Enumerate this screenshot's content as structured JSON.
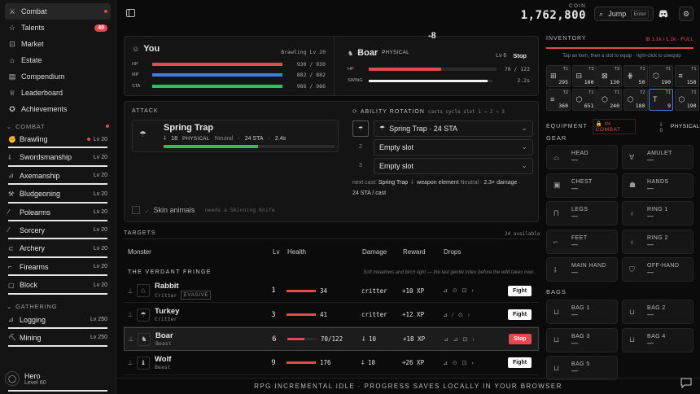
{
  "nav": [
    {
      "label": "Combat",
      "icon": "swords-icon",
      "dot": true
    },
    {
      "label": "Talents",
      "icon": "star-icon",
      "badge": "40"
    },
    {
      "label": "Market",
      "icon": "cart-icon"
    },
    {
      "label": "Estate",
      "icon": "home-icon"
    },
    {
      "label": "Compendium",
      "icon": "book-icon"
    },
    {
      "label": "Leaderboard",
      "icon": "trophy-icon"
    },
    {
      "label": "Achievements",
      "icon": "medal-icon"
    }
  ],
  "combat_section": "COMBAT",
  "combat_skills": [
    {
      "label": "Brawling",
      "lv": "Lv 20",
      "dot": true
    },
    {
      "label": "Swordsmanship",
      "lv": "Lv 20"
    },
    {
      "label": "Axemanship",
      "lv": "Lv 20"
    },
    {
      "label": "Bludgeoning",
      "lv": "Lv 20"
    },
    {
      "label": "Polearms",
      "lv": "Lv 20"
    },
    {
      "label": "Sorcery",
      "lv": "Lv 20"
    },
    {
      "label": "Archery",
      "lv": "Lv 20"
    },
    {
      "label": "Firearms",
      "lv": "Lv 20"
    },
    {
      "label": "Block",
      "lv": "Lv 20"
    }
  ],
  "gathering_section": "GATHERING",
  "gathering_skills": [
    {
      "label": "Logging",
      "lv": "Lv 250"
    },
    {
      "label": "Mining",
      "lv": "Lv 250"
    }
  ],
  "hero": {
    "name": "Hero",
    "level": "Level 60"
  },
  "coin": {
    "label": "COIN",
    "value": "1,762,800"
  },
  "jump": {
    "label": "Jump",
    "kbd": "Enter"
  },
  "damage_popup": "-8",
  "you": {
    "title": "You",
    "skill": "Brawling Lv 20",
    "stats": [
      {
        "k": "HP",
        "v": "930 / 930",
        "pct": 100,
        "color": "#e5484d"
      },
      {
        "k": "MP",
        "v": "882 / 882",
        "pct": 100,
        "color": "#3e7fe6"
      },
      {
        "k": "STA",
        "v": "986 / 986",
        "pct": 100,
        "color": "#2fbf5b"
      }
    ]
  },
  "enemy": {
    "name": "Boar",
    "tag": "PHYSICAL",
    "lv": "Lv 6",
    "stop": "Stop",
    "hp_label": "HP",
    "hp_value": "70 / 122",
    "hp_pct": 57,
    "swing_label": "SWING",
    "swing_value": "2.2s",
    "swing_pct": 96
  },
  "attack": {
    "title": "ATTACK",
    "name": "Spring Trap",
    "dmg": "18",
    "type": "PHYSICAL",
    "element": "Neutral",
    "cost": "24 STA",
    "time": "2.4s",
    "progress": 55
  },
  "rotation": {
    "title": "ABILITY ROTATION",
    "hint": "casts cycle slot 1 → 2 → 3",
    "slots": [
      {
        "num": "",
        "label": "Spring Trap · 24 STA"
      },
      {
        "num": "2",
        "label": "Empty slot"
      },
      {
        "num": "3",
        "label": "Empty slot"
      }
    ],
    "next_label": "next cast:",
    "next_name": "Spring Trap",
    "next_el_label": "weapon element",
    "next_el": "Neutral",
    "next_mult": "2.3× damage",
    "next_cost": "24 STA / cast"
  },
  "skin": {
    "label": "Skin animals",
    "note": "needs a Skinning Knife"
  },
  "targets": {
    "title": "TARGETS",
    "count": "24 available",
    "headers": {
      "monster": "Monster",
      "lv": "Lv",
      "health": "Health",
      "damage": "Damage",
      "reward": "Reward",
      "drops": "Drops"
    },
    "zone": "THE VERDANT FRINGE",
    "zone_desc": "Soft meadows and birch light — the last gentle miles before the wild takes over.",
    "rows": [
      {
        "name": "Rabbit",
        "type": "Critter",
        "tag": "EVASIVE",
        "lv": "1",
        "hp": "34",
        "hp_pct": 100,
        "dmg": "critter",
        "reward": "+10 XP",
        "drops": "⊿ ⊙ ⊡ ›",
        "btn": "Fight",
        "icon": "rabbit-icon"
      },
      {
        "name": "Turkey",
        "type": "Critter",
        "lv": "3",
        "hp": "41",
        "hp_pct": 100,
        "dmg": "critter",
        "reward": "+12 XP",
        "drops": "⊿ ⁄ ⊙ ›",
        "btn": "Fight",
        "icon": "turkey-icon"
      },
      {
        "name": "Boar",
        "type": "Beast",
        "lv": "6",
        "hp": "70/122",
        "hp_pct": 57,
        "dmg": "10",
        "reward": "+18 XP",
        "drops": "⊿ ⊿ ⊡ ›",
        "btn": "Stop",
        "icon": "boar-icon",
        "active": true
      },
      {
        "name": "Wolf",
        "type": "Beast",
        "lv": "9",
        "hp": "176",
        "hp_pct": 100,
        "dmg": "10",
        "reward": "+26 XP",
        "drops": "⊿ ⊙ ⊡ ›",
        "btn": "Fight",
        "icon": "wolf-icon"
      }
    ]
  },
  "inventory": {
    "title": "INVENTORY",
    "capacity": "1.1k / 1.1k · FULL",
    "hint": "Tap an item, then a slot to equip · right-click to unequip",
    "slots": [
      {
        "tier": "T1",
        "count": "295"
      },
      {
        "tier": "T3",
        "count": "100"
      },
      {
        "tier": "T3",
        "count": "130"
      },
      {
        "tier": "T1",
        "count": "50"
      },
      {
        "tier": "T1",
        "count": "190"
      },
      {
        "tier": "T1",
        "count": "150"
      },
      {
        "tier": "T2",
        "count": "360"
      },
      {
        "tier": "T1",
        "count": "651"
      },
      {
        "tier": "T1",
        "count": "240"
      },
      {
        "tier": "T2",
        "count": "180"
      },
      {
        "tier": "T1",
        "count": "9"
      },
      {
        "tier": "T1",
        "count": "190"
      }
    ]
  },
  "equipment": {
    "title": "EQUIPMENT",
    "status": "IN COMBAT",
    "type_num": "0",
    "type": "PHYSICAL"
  },
  "gear_title": "GEAR",
  "gear": [
    {
      "label": "HEAD",
      "value": "—",
      "icon": "helmet-icon"
    },
    {
      "label": "AMULET",
      "value": "—",
      "icon": "amulet-icon"
    },
    {
      "label": "CHEST",
      "value": "—",
      "icon": "chest-icon"
    },
    {
      "label": "HANDS",
      "value": "—",
      "icon": "gloves-icon"
    },
    {
      "label": "LEGS",
      "value": "—",
      "icon": "legs-icon"
    },
    {
      "label": "RING 1",
      "value": "—",
      "icon": "ring-icon"
    },
    {
      "label": "FEET",
      "value": "—",
      "icon": "boots-icon"
    },
    {
      "label": "RING 2",
      "value": "—",
      "icon": "ring-icon"
    },
    {
      "label": "MAIN HAND",
      "value": "—",
      "icon": "sword-icon"
    },
    {
      "label": "OFF-HAND",
      "value": "—",
      "icon": "shield-icon"
    }
  ],
  "bags_title": "BAGS",
  "bags": [
    {
      "label": "BAG 1",
      "value": "—"
    },
    {
      "label": "BAG 2",
      "value": "—"
    },
    {
      "label": "BAG 3",
      "value": "—"
    },
    {
      "label": "BAG 4",
      "value": "—"
    },
    {
      "label": "BAG 5",
      "value": "—"
    }
  ],
  "footer": "RPG INCREMENTAL IDLE · PROGRESS SAVES LOCALLY IN YOUR BROWSER"
}
